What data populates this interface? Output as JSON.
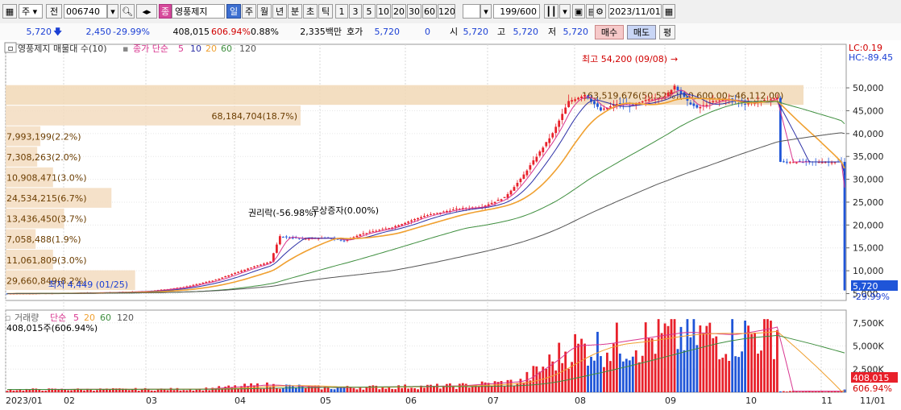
{
  "toolbar": {
    "market": "주",
    "prev_label": "전",
    "code": "006740",
    "badge": "종",
    "stock_name": "영풍제지",
    "periods": [
      "일",
      "주",
      "월",
      "년",
      "분",
      "초",
      "틱"
    ],
    "active_period": "일",
    "multipliers": [
      "1",
      "3",
      "5",
      "10",
      "20",
      "30",
      "60",
      "120"
    ],
    "count": "199/600",
    "date": "2023/11/01",
    "icons": [
      "grid-icon",
      "search-icon",
      "speaker-icon",
      "candle-icon",
      "save-icon",
      "print-icon",
      "gear-icon"
    ]
  },
  "quote": {
    "price": "5,720",
    "change": "2,450",
    "change_pct": "-29.99%",
    "volume": "408,015",
    "volume_ratio": "606.94%",
    "turnover": "0.88%",
    "amount": "2,335백만",
    "bid_label": "호가",
    "bid_price": "5,720",
    "bid_qty": "0",
    "open_label": "시",
    "open": "5,720",
    "high_label": "고",
    "high": "5,720",
    "low_label": "저",
    "low": "5,720",
    "buy_label": "매수",
    "sell_label": "매도",
    "avg_label": "평"
  },
  "price_panel": {
    "legend_name": "영풍제지 매물대 수(10)",
    "legend_ma": "종가 단순",
    "ma_periods": [
      "5",
      "10",
      "20",
      "60",
      "120"
    ],
    "lc": "LC:0.19",
    "hc": "HC:-89.45",
    "current_price_label": "5,720",
    "current_change_label": "-29.99%",
    "high_annotation": "최고 54,200 (09/08)",
    "ann_rights": "권리락(-56.98%)",
    "ann_bonus": "무상증자(0.00%)",
    "ann_low": "최저 4,449 (01/25)",
    "top_profile_label": "163,519,676(50.52%)(50,600.00~46,112.00)",
    "profile_colors": {
      "bar": "#f3dcc0",
      "bar_top": "#f1d8b6",
      "text": "#6b3d00"
    }
  },
  "volume_panel": {
    "legend_name": "거래량",
    "legend_ma": "단순",
    "ma_periods": [
      "5",
      "20",
      "60",
      "120"
    ],
    "info": "408,015주(606.94%)",
    "current_label": "408,015",
    "current_pct": "606.94%"
  },
  "colors": {
    "up": "#e8202a",
    "down": "#1f55d8",
    "ma5": "#d8358f",
    "ma10": "#2b2fa6",
    "ma20": "#f0a030",
    "ma60": "#3e8e3e",
    "ma120": "#555555"
  },
  "chart_data": {
    "type": "candlestick",
    "x_ticks": [
      "2023/01",
      "02",
      "03",
      "04",
      "05",
      "06",
      "07",
      "08",
      "09",
      "10",
      "11",
      "11/01"
    ],
    "y_ticks": [
      "50,000",
      "45,000",
      "40,000",
      "35,000",
      "30,000",
      "25,000",
      "20,000",
      "15,000",
      "10,000",
      "5,000"
    ],
    "ylim": [
      3500,
      56000
    ],
    "volume_ticks": [
      "7,500K",
      "5,000K",
      "2,500K"
    ],
    "volume_ylim": [
      0,
      8000
    ],
    "volume_profile": [
      {
        "label": "163,519,676(50.52%)",
        "low": 46112,
        "high": 50600,
        "pct": 50.52
      },
      {
        "label": "68,184,704(18.7%)",
        "low": 41600,
        "high": 46100,
        "pct": 18.7
      },
      {
        "label": "7,993,199(2.2%)",
        "low": 37100,
        "high": 41600,
        "pct": 2.2
      },
      {
        "label": "7,308,263(2.0%)",
        "low": 32600,
        "high": 37100,
        "pct": 2.0
      },
      {
        "label": "10,908,471(3.0%)",
        "low": 28100,
        "high": 32600,
        "pct": 3.0
      },
      {
        "label": "24,534,215(6.7%)",
        "low": 23600,
        "high": 28100,
        "pct": 6.7
      },
      {
        "label": "13,436,450(3.7%)",
        "low": 19100,
        "high": 23600,
        "pct": 3.7
      },
      {
        "label": "7,058,488(1.9%)",
        "low": 14600,
        "high": 19100,
        "pct": 1.9
      },
      {
        "label": "11,061,809(3.0%)",
        "low": 10100,
        "high": 14600,
        "pct": 3.0
      },
      {
        "label": "29,660,849(8.2%)",
        "low": 5600,
        "high": 10100,
        "pct": 8.2
      }
    ],
    "close_anchors": [
      [
        0,
        5000
      ],
      [
        20,
        5100
      ],
      [
        35,
        5300
      ],
      [
        45,
        5600
      ],
      [
        55,
        6400
      ],
      [
        65,
        8000
      ],
      [
        75,
        10500
      ],
      [
        82,
        12000
      ],
      [
        85,
        17500
      ],
      [
        92,
        17000
      ],
      [
        100,
        17200
      ],
      [
        105,
        16500
      ],
      [
        110,
        18000
      ],
      [
        120,
        19500
      ],
      [
        130,
        22000
      ],
      [
        140,
        23500
      ],
      [
        148,
        24000
      ],
      [
        155,
        26000
      ],
      [
        160,
        30000
      ],
      [
        165,
        35000
      ],
      [
        170,
        40000
      ],
      [
        175,
        47000
      ],
      [
        180,
        48500
      ],
      [
        185,
        45000
      ],
      [
        190,
        46500
      ],
      [
        195,
        46000
      ],
      [
        200,
        47500
      ],
      [
        205,
        48000
      ],
      [
        208,
        50500
      ],
      [
        212,
        47000
      ],
      [
        215,
        45500
      ],
      [
        220,
        47000
      ],
      [
        225,
        47500
      ],
      [
        230,
        46500
      ],
      [
        235,
        47000
      ],
      [
        240,
        47800
      ],
      [
        241,
        33800
      ],
      [
        250,
        33800
      ],
      [
        260,
        33800
      ],
      [
        261,
        5720
      ]
    ],
    "volume_anchors": [
      [
        0,
        300
      ],
      [
        60,
        350
      ],
      [
        80,
        800
      ],
      [
        100,
        500
      ],
      [
        140,
        700
      ],
      [
        160,
        1200
      ],
      [
        170,
        3500
      ],
      [
        175,
        5000
      ],
      [
        185,
        5200
      ],
      [
        200,
        6000
      ],
      [
        210,
        6500
      ],
      [
        225,
        6200
      ],
      [
        235,
        6800
      ],
      [
        240,
        7200
      ],
      [
        241,
        120
      ],
      [
        260,
        120
      ],
      [
        261,
        408
      ]
    ]
  }
}
